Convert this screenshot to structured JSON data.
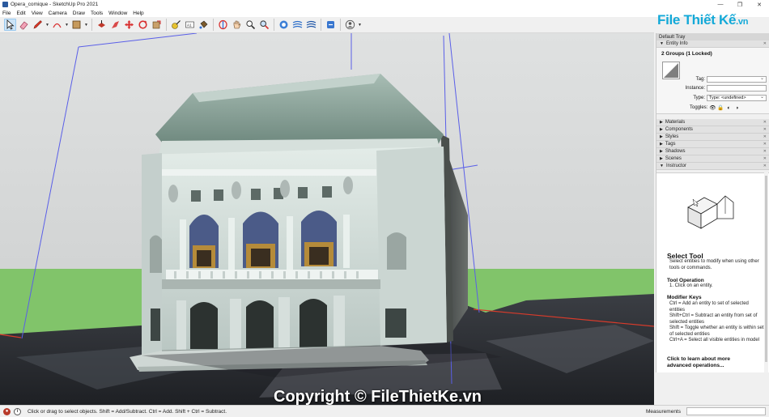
{
  "window": {
    "title": "Opera_comique - SketchUp Pro 2021",
    "minimize": "—",
    "maximize": "❐",
    "close": "✕"
  },
  "menu": [
    "File",
    "Edit",
    "View",
    "Camera",
    "Draw",
    "Tools",
    "Window",
    "Help"
  ],
  "toolbar": {
    "tools": [
      {
        "icon": "select-arrow-icon",
        "active": true
      },
      {
        "icon": "eraser-icon"
      },
      {
        "icon": "pencil-line-icon",
        "dropdown": true
      },
      {
        "icon": "arc-icon",
        "dropdown": true
      },
      {
        "icon": "rectangle-icon",
        "dropdown": true
      },
      {
        "icon": "push-pull-icon"
      },
      {
        "icon": "follow-me-icon"
      },
      {
        "icon": "move-icon"
      },
      {
        "icon": "rotate-icon"
      },
      {
        "icon": "scale-icon"
      },
      {
        "icon": "offset-icon"
      },
      {
        "icon": "tape-measure-icon"
      },
      {
        "icon": "dimension-icon"
      },
      {
        "icon": "paint-bucket-icon"
      },
      {
        "icon": "orbit-icon"
      },
      {
        "icon": "pan-icon"
      },
      {
        "icon": "zoom-icon"
      },
      {
        "icon": "zoom-extents-icon"
      },
      {
        "icon": "3d-warehouse-icon"
      },
      {
        "icon": "extension-warehouse-icon"
      },
      {
        "icon": "layout-icon"
      },
      {
        "icon": "extension-manager-icon"
      },
      {
        "icon": "profile-icon",
        "dropdown": true
      }
    ]
  },
  "viewport": {
    "watermark": "Copyright © FileThietKe.vn"
  },
  "logo": {
    "text": "File Thiết Kế",
    "suffix": ".vn"
  },
  "tray": {
    "title": "Default Tray",
    "entity_info": {
      "header": "Entity Info",
      "selection": "2 Groups (1 Locked)",
      "tag_label": "Tag:",
      "tag_value": "",
      "instance_label": "Instance:",
      "instance_value": "",
      "type_label": "Type:",
      "type_value": "Type: <undefined>",
      "toggles_label": "Toggles:"
    },
    "panels": [
      "Materials",
      "Components",
      "Styles",
      "Tags",
      "Shadows",
      "Scenes",
      "Instructor"
    ],
    "instructor": {
      "title": "Select Tool",
      "intro": "Select entities to modify when using other tools or commands.",
      "op_heading": "Tool Operation",
      "op_items": [
        "1. Click on an entity."
      ],
      "mod_heading": "Modifier Keys",
      "mod_items": [
        "Ctrl = Add an entity to set of selected entities",
        "Shift+Ctrl = Subtract an entity from set of selected entities",
        "Shift = Toggle whether an entity is within set of selected entities",
        "Ctrl+A = Select all visible entities in model"
      ],
      "link": "Click to learn about more advanced operations..."
    }
  },
  "status": {
    "message": "Click or drag to select objects. Shift = Add/Subtract. Ctrl = Add. Shift + Ctrl = Subtract.",
    "measurements_label": "Measurements",
    "measurements_value": ""
  },
  "colors": {
    "sky": "#d7d9d8",
    "grass": "#81c46a",
    "ground": "#303338",
    "bounding_box": "#5a5fe8",
    "logo": "#13a9d8",
    "facade": "#d9e4e0",
    "roof": "#8aa39a"
  }
}
